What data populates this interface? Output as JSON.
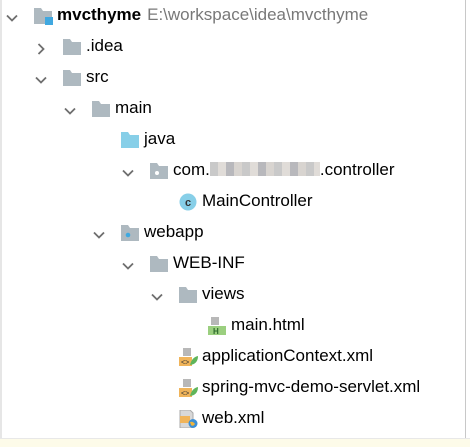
{
  "tree": {
    "root": {
      "name": "mvcthyme",
      "path": "E:\\workspace\\idea\\mvcthyme",
      "expanded": true,
      "icon": "module-folder-icon"
    },
    "items": [
      {
        "name": ".idea",
        "level": 1,
        "expanded": false,
        "icon": "folder-icon"
      },
      {
        "name": "src",
        "level": 1,
        "expanded": true,
        "icon": "folder-icon"
      },
      {
        "name": "main",
        "level": 2,
        "expanded": true,
        "icon": "folder-icon"
      },
      {
        "name": "java",
        "level": 3,
        "expanded": null,
        "icon": "source-folder-icon"
      },
      {
        "name_prefix": "com.",
        "name_suffix": ".controller",
        "level": 4,
        "expanded": true,
        "icon": "package-icon"
      },
      {
        "name": "MainController",
        "level": 5,
        "expanded": null,
        "icon": "class-icon"
      },
      {
        "name": "webapp",
        "level": 3,
        "expanded": true,
        "icon": "web-folder-icon"
      },
      {
        "name": "WEB-INF",
        "level": 4,
        "expanded": true,
        "icon": "folder-icon"
      },
      {
        "name": "views",
        "level": 5,
        "expanded": true,
        "icon": "folder-icon"
      },
      {
        "name": "main.html",
        "level": 6,
        "expanded": null,
        "icon": "html-file-icon"
      },
      {
        "name": "applicationContext.xml",
        "level": 5,
        "expanded": null,
        "icon": "spring-xml-icon"
      },
      {
        "name": "spring-mvc-demo-servlet.xml",
        "level": 5,
        "expanded": null,
        "icon": "spring-xml-icon"
      },
      {
        "name": "web.xml",
        "level": 5,
        "expanded": null,
        "icon": "web-xml-icon"
      }
    ]
  },
  "colors": {
    "folder": "#aeb9c0",
    "source_folder": "#87cfe8",
    "class_icon": "#87cfe8",
    "html_green": "#9bcf7f",
    "xml_orange": "#f0b45a",
    "spring_green": "#5fb55a"
  }
}
